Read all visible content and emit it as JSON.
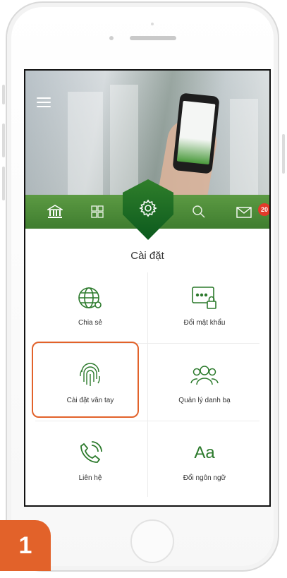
{
  "screen": {
    "title": "Cài đặt",
    "notification_count": "20"
  },
  "nav": {
    "items": [
      "bank-icon",
      "grid-icon",
      "gear-icon",
      "search-icon",
      "mail-icon"
    ]
  },
  "settings": {
    "share": "Chia sẻ",
    "change_password": "Đổi mật khẩu",
    "fingerprint": "Cài đặt vân tay",
    "contacts": "Quản lý danh bạ",
    "contact_us": "Liên hệ",
    "language": "Đổi ngôn ngữ",
    "language_glyph": "Aa"
  },
  "step_number": "1",
  "colors": {
    "accent_green": "#2c7a2c",
    "highlight_orange": "#e2622a",
    "badge_red": "#e23a2a"
  }
}
